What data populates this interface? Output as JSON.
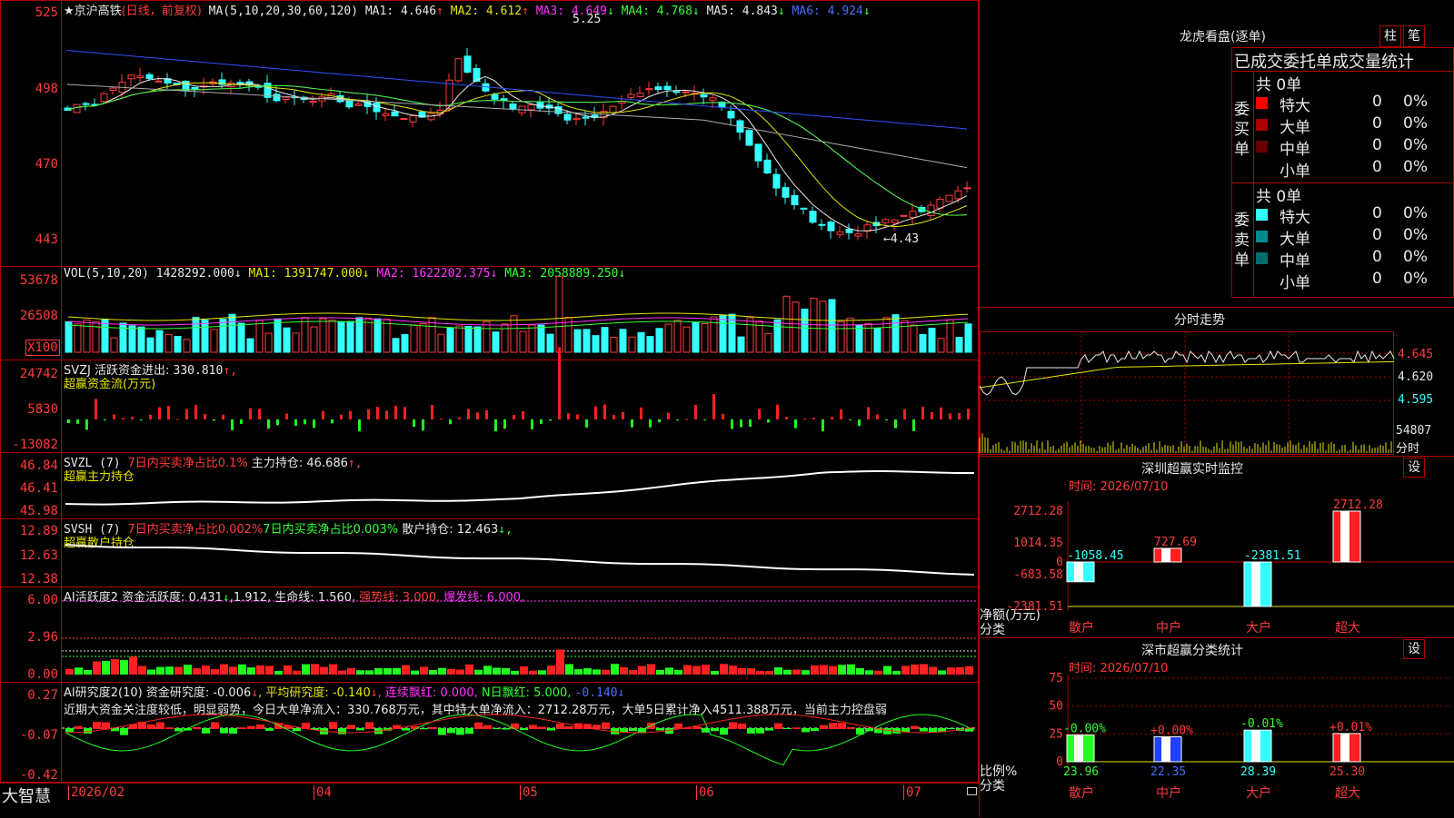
{
  "app": {
    "brand": "大智慧"
  },
  "stock": {
    "star": "★",
    "name": "京沪高铁",
    "mode": "(日线，前复权)",
    "ma_formula": "MA(5,10,20,30,60,120)",
    "ma1": "MA1: 4.646",
    "ma1_arrow": "↑",
    "ma2": "MA2: 4.612",
    "ma2_arrow": "↑",
    "ma3": "MA3: 4.649",
    "ma3_arrow": "↓",
    "ma4": "MA4: 4.768",
    "ma4_arrow": "↓",
    "ma5": "MA5: 4.843",
    "ma5_arrow": "↓",
    "ma6": "MA6: 4.924",
    "ma6_arrow": "↓",
    "high_marker": "5.25",
    "low_marker": "←4.43",
    "price_ticks": [
      "525",
      "498",
      "470",
      "443"
    ]
  },
  "volume": {
    "formula": "VOL(5,10,20)",
    "vol": "1428292.000↓",
    "ma1": "MA1: 1391747.000↓",
    "ma2": "MA2: 1622202.375↓",
    "ma3": "MA3: 2058889.250↓",
    "ticks": [
      "53678",
      "26508"
    ],
    "unit": "X100"
  },
  "svzj": {
    "line1_a": "SVZJ  活跃资金进出: ",
    "line1_b": "330.810",
    "line1_arrow": "↑,",
    "line2": "超赢资金流(万元)",
    "ticks": [
      "24742",
      "5830",
      "-13082"
    ]
  },
  "svzl": {
    "a": "SVZL (7) ",
    "b": "7日内买卖净占比0.1%",
    "c": " 主力持仓: 46.686",
    "arrow": "↑,",
    "line2": "超赢主力持仓",
    "ticks": [
      "46.84",
      "46.41",
      "45.98"
    ]
  },
  "svsh": {
    "a": "SVSH (7) ",
    "b": "7日内买卖净占比0.002%",
    "c": "7日内买卖净占比0.003%",
    "d": " 散户持仓: 12.463",
    "arrow": "↓,",
    "line2": "超赢散户持仓",
    "ticks": [
      "12.89",
      "12.63",
      "12.38"
    ]
  },
  "ai_active": {
    "a": "AI活跃度2 资金活跃度: 0.431",
    "b": "↓",
    "c": ",1.912, 生命线: 1.560, ",
    "d": "强势线: 3.000, ",
    "e": "爆发线: 6.000,",
    "ticks": [
      "6.00",
      "2.96",
      "0.00"
    ]
  },
  "ai_research": {
    "a": "AI研究度2(10) 资金研究度: -0.006",
    "b": "↓",
    "c": ", 平均研究度: -0.140",
    "d": "↓",
    "e": ", 连续飘红: 0.000, ",
    "f": "N日飘红: 5.000, ",
    "g": "-0.140↓",
    "summary": "近期大资金关注度较低，明显弱势，今日大单净流入：330.768万元，其中特大单净流入：2712.28万元，大单5日累计净入4511.388万元，当前主力控盘弱",
    "ticks": [
      "0.27",
      "-0.07",
      "-0.42"
    ]
  },
  "dates": [
    "2026/02",
    "04",
    "05",
    "06",
    "07"
  ],
  "right": {
    "dragon": {
      "title": "龙虎看盘(逐单)",
      "btn1": "柱",
      "btn2": "笔",
      "subtitle": "已成交委托单成交量统计",
      "buy_label": "委买单",
      "sell_label": "委卖单",
      "buy_total": "共 0单",
      "sell_total": "共 0单",
      "buy_rows": [
        {
          "name": "特大",
          "v": "0",
          "p": "0%",
          "color": "#ff0000"
        },
        {
          "name": "大单",
          "v": "0",
          "p": "0%",
          "color": "#aa0000"
        },
        {
          "name": "中单",
          "v": "0",
          "p": "0%",
          "color": "#660000"
        },
        {
          "name": "小单",
          "v": "0",
          "p": "0%",
          "color": ""
        }
      ],
      "sell_rows": [
        {
          "name": "特大",
          "v": "0",
          "p": "0%",
          "color": "#33ffff"
        },
        {
          "name": "大单",
          "v": "0",
          "p": "0%",
          "color": "#008c8c"
        },
        {
          "name": "中单",
          "v": "0",
          "p": "0%",
          "color": "#006e6e"
        },
        {
          "name": "小单",
          "v": "0",
          "p": "0%",
          "color": ""
        }
      ]
    },
    "intraday": {
      "title": "分时走势",
      "ticks": [
        "4.645",
        "4.620",
        "4.595"
      ],
      "vol_tick": "54807",
      "vol_unit": "分时"
    },
    "monitor": {
      "title": "深圳超赢实时监控",
      "btn": "设",
      "time": "时间: 2026/07/10",
      "ticks": [
        "2712.28",
        "1014.35",
        "0",
        "-683.58",
        "-2381.51"
      ],
      "ylabel": "净额(万元)",
      "xlabel": "分类"
    },
    "classify": {
      "title": "深市超赢分类统计",
      "btn": "设",
      "time": "时间: 2026/07/10",
      "ticks": [
        "75",
        "50",
        "25",
        "0"
      ],
      "ylabel": "比例%",
      "xlabel": "分类"
    }
  },
  "chart_data": [
    {
      "type": "bar",
      "title": "深圳超赢实时监控",
      "categories": [
        "散户",
        "中户",
        "大户",
        "超大"
      ],
      "values": [
        -1058.45,
        727.69,
        -2381.51,
        2712.28
      ],
      "ylim": [
        -2381.51,
        2712.28
      ]
    },
    {
      "type": "bar",
      "title": "深市超赢分类统计",
      "categories": [
        "散户",
        "中户",
        "大户",
        "超大"
      ],
      "series": [
        {
          "values": [
            23.96,
            22.35,
            28.39,
            25.3
          ]
        },
        {
          "values": [
            "-0.00%",
            "+0.00%",
            "-0.01%",
            "+0.01%"
          ]
        }
      ],
      "ylim": [
        0,
        75
      ]
    }
  ]
}
